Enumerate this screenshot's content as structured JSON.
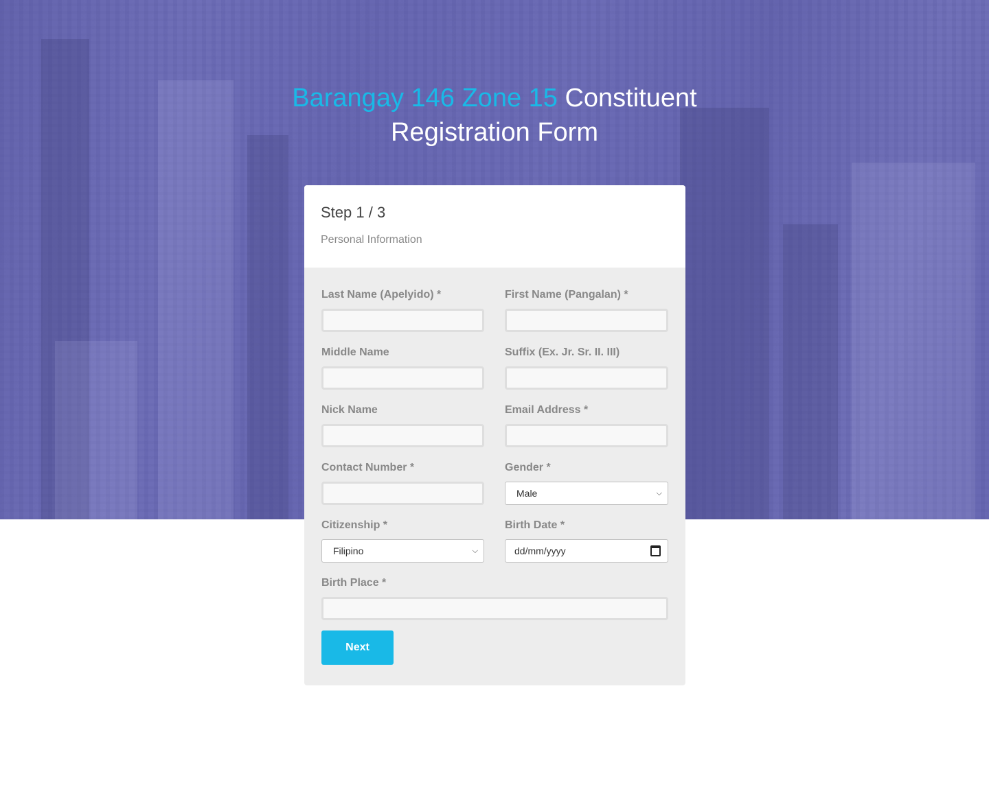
{
  "header": {
    "title_accent": "Barangay 146 Zone 15",
    "title_rest": "Constituent",
    "title_line2": "Registration Form"
  },
  "card": {
    "step": "Step 1 / 3",
    "subtitle": "Personal Information"
  },
  "fields": {
    "last_name": {
      "label": "Last Name (Apelyido)",
      "required": "*",
      "value": ""
    },
    "first_name": {
      "label": "First Name (Pangalan)",
      "required": "*",
      "value": ""
    },
    "middle_name": {
      "label": "Middle Name",
      "value": ""
    },
    "suffix": {
      "label": "Suffix (Ex. Jr. Sr. II. III)",
      "value": ""
    },
    "nick_name": {
      "label": "Nick Name",
      "value": ""
    },
    "email": {
      "label": "Email Address",
      "required": "*",
      "value": ""
    },
    "contact": {
      "label": "Contact Number",
      "required": "*",
      "value": ""
    },
    "gender": {
      "label": "Gender",
      "required": "*",
      "selected": "Male"
    },
    "citizenship": {
      "label": "Citizenship",
      "required": "*",
      "selected": "Filipino"
    },
    "birth_date": {
      "label": "Birth Date",
      "required": "*",
      "placeholder": "dd/mm/yyyy"
    },
    "birth_place": {
      "label": "Birth Place",
      "required": "*",
      "value": ""
    }
  },
  "actions": {
    "next_label": "Next"
  },
  "colors": {
    "accent": "#19b9e7",
    "hero_overlay": "#6b6bb4",
    "card_bg": "#ededed"
  },
  "icons": {
    "select_arrow": "chevron-down-icon",
    "date_picker": "calendar-icon"
  }
}
